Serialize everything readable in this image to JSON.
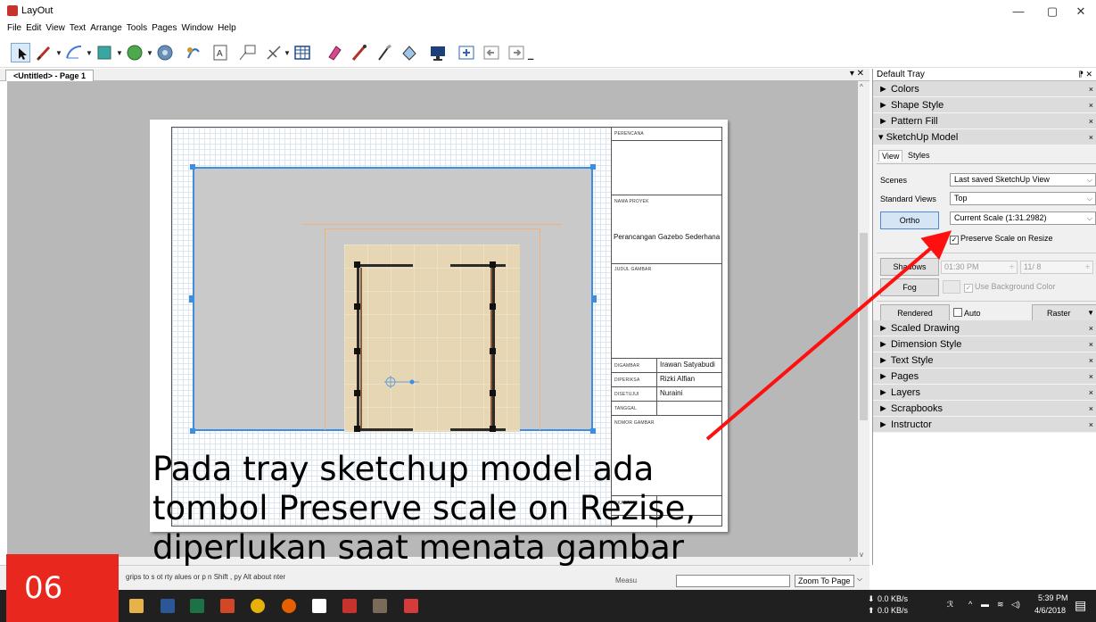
{
  "window": {
    "title": "LayOut",
    "controls": [
      "—",
      "▢",
      "✕"
    ]
  },
  "menubar": [
    "File",
    "Edit",
    "View",
    "Text",
    "Arrange",
    "Tools",
    "Pages",
    "Window",
    "Help"
  ],
  "document": {
    "tab_label": "<Untitled> - Page 1",
    "close_label": "▾ ✕"
  },
  "title_block": {
    "perencana_label": "PERENCANA",
    "nama_proyek_label": "NAMA PROYEK",
    "project_name": "Perancangan Gazebo Sederhana",
    "judul_gambar_label": "JUDUL GAMBAR",
    "digambar_label": "DIGAMBAR",
    "digambar_value": "Irawan Satyabudi",
    "diperiksa_label": "DIPERIKSA",
    "diperiksa_value": "Rizki Alfian",
    "disetujui_label": "DISETUJUI",
    "disetujui_value": "Nuraini",
    "tanggal_label": "TANGGAL",
    "nomor_gambar_label": "NOMOR GAMBAR",
    "skala_label": "SKALA"
  },
  "annotation": {
    "line1": "Pada tray sketchup model ada",
    "line2": "tombol Preserve scale on Rezise,",
    "line3": "diperlukan saat menata gambar"
  },
  "tray": {
    "title": "Default Tray",
    "pin": "⁋ ✕",
    "panels_top": [
      "Colors",
      "Shape Style",
      "Pattern Fill"
    ],
    "sketchup_model": {
      "header": "SketchUp Model",
      "tab_view": "View",
      "tab_styles": "Styles",
      "scenes_label": "Scenes",
      "scenes_value": "Last saved SketchUp View",
      "standard_views_label": "Standard Views",
      "standard_views_value": "Top",
      "ortho_button": "Ortho",
      "scale_value": "Current Scale (1:31.2982)",
      "preserve_scale_label": "Preserve Scale on Resize",
      "shadows_button": "Shadows",
      "shadow_time": "01:30 PM",
      "shadow_date": "11/ 8",
      "fog_button": "Fog",
      "use_bg_color_label": "Use Background Color",
      "rendered_button": "Rendered",
      "auto_label": "Auto",
      "raster_value": "Raster"
    },
    "panels_bottom": [
      "Scaled Drawing",
      "Dimension Style",
      "Text Style",
      "Pages",
      "Layers",
      "Scrapbooks",
      "Instructor"
    ]
  },
  "statusbar": {
    "hint": "grips to s         ot       rty    alues or         p       n    Shift         ,     py    Alt about       nter",
    "measurements_label": "Measu",
    "zoom_value": "Zoom To Page"
  },
  "badge": "06",
  "system_tray": {
    "net_down": "0.0 KB/s",
    "net_up": "0.0 KB/s",
    "time": "5:39 PM",
    "date": "4/6/2018"
  },
  "colors": {
    "selection": "#3d8ee0",
    "arrow": "#ff1010",
    "badge": "#e8271e",
    "taskbar": "#202020"
  }
}
